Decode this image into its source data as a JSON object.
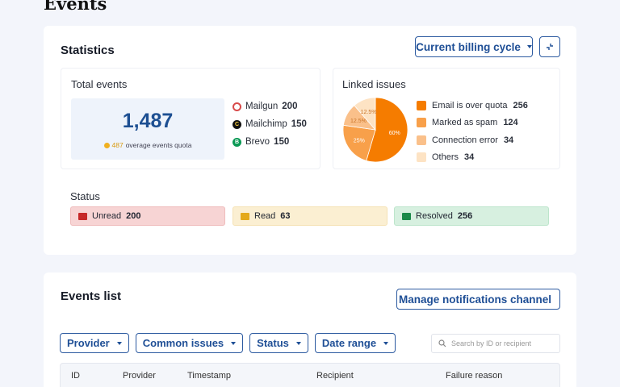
{
  "page": {
    "title": "Events"
  },
  "statistics": {
    "title": "Statistics",
    "billing_cycle_label": "Current billing cycle",
    "total_events": {
      "title": "Total events",
      "value": "1,487",
      "overage_value": "487",
      "overage_label": "overage events quota",
      "providers": [
        {
          "name": "Mailgun",
          "count": "200",
          "icon": "mailgun-icon"
        },
        {
          "name": "Mailchimp",
          "count": "150",
          "icon": "mailchimp-icon"
        },
        {
          "name": "Brevo",
          "count": "150",
          "icon": "brevo-icon"
        }
      ]
    },
    "linked_issues": {
      "title": "Linked issues",
      "legend": [
        {
          "label": "Email is over quota",
          "count": "256",
          "color": "#f57c00"
        },
        {
          "label": "Marked as spam",
          "count": "124",
          "color": "#f8a04a"
        },
        {
          "label": "Connection error",
          "count": "34",
          "color": "#fac08a"
        },
        {
          "label": "Others",
          "count": "34",
          "color": "#fde3c4"
        }
      ]
    },
    "status": {
      "title": "Status",
      "items": [
        {
          "label": "Unread",
          "count": "200",
          "bg": "#f7d4d4",
          "border": "#efbcbc",
          "icon_color": "#c62828"
        },
        {
          "label": "Read",
          "count": "63",
          "bg": "#fbefd2",
          "border": "#f5e2b4",
          "icon_color": "#e4a91b"
        },
        {
          "label": "Resolved",
          "count": "256",
          "bg": "#d7f0e0",
          "border": "#bde5cc",
          "icon_color": "#1b8a4a"
        }
      ]
    }
  },
  "chart_data": {
    "type": "pie",
    "categories": [
      "Email is over quota",
      "Marked as spam",
      "Connection error",
      "Others"
    ],
    "values": [
      60,
      25,
      12.5,
      12.5
    ],
    "labels": [
      "60%",
      "25%",
      "12.5%",
      "12.5%"
    ],
    "colors": [
      "#f57c00",
      "#f8a04a",
      "#fac08a",
      "#fde3c4"
    ]
  },
  "events_list": {
    "title": "Events list",
    "manage_label": "Manage notifications channel",
    "filters": [
      "Provider",
      "Common issues",
      "Status",
      "Date range"
    ],
    "search_placeholder": "Search by ID or recipient",
    "columns": [
      "ID",
      "Provider",
      "Timestamp",
      "Recipient",
      "Failure reason"
    ]
  }
}
